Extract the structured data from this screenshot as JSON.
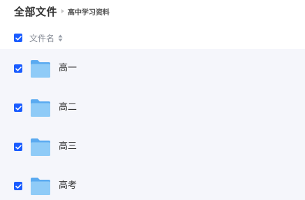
{
  "breadcrumb": {
    "root": "全部文件",
    "current": "高中学习资料"
  },
  "table": {
    "column_name": "文件名"
  },
  "colors": {
    "accent": "#1a5cff",
    "folder": "#7ec0f2",
    "list_bg": "#f5f6fb"
  },
  "files": [
    {
      "name": "高一",
      "type": "folder-icon",
      "checked": true
    },
    {
      "name": "高二",
      "type": "folder-icon",
      "checked": true
    },
    {
      "name": "高三",
      "type": "folder-icon",
      "checked": true
    },
    {
      "name": "高考",
      "type": "folder-icon",
      "checked": true
    }
  ]
}
